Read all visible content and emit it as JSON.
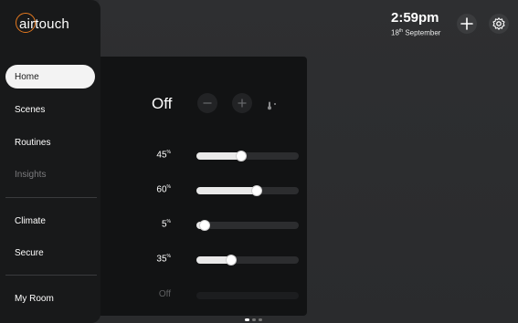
{
  "app": {
    "logo_text": "airtouch"
  },
  "sidebar": {
    "items": [
      {
        "label": "Home",
        "state": "active"
      },
      {
        "label": "Scenes",
        "state": "normal"
      },
      {
        "label": "Routines",
        "state": "normal"
      },
      {
        "label": "Insights",
        "state": "dim"
      },
      {
        "label": "Climate",
        "state": "normal"
      },
      {
        "label": "Secure",
        "state": "normal"
      },
      {
        "label": "My Room",
        "state": "normal"
      }
    ]
  },
  "header": {
    "time": "2:59pm",
    "date_day": "18",
    "date_suffix": "th",
    "date_month": "September",
    "add_icon": "plus-icon",
    "settings_icon": "gear-icon"
  },
  "panel": {
    "status": "Off",
    "minus_icon": "minus-icon",
    "plus_icon": "plus-icon",
    "thermo_icon": "thermometer-icon",
    "zones": [
      {
        "value": "45",
        "unit": "%",
        "level": 0.45,
        "enabled": true
      },
      {
        "value": "60",
        "unit": "%",
        "level": 0.6,
        "enabled": true
      },
      {
        "value": "5",
        "unit": "%",
        "level": 0.05,
        "enabled": true
      },
      {
        "value": "35",
        "unit": "%",
        "level": 0.35,
        "enabled": true
      },
      {
        "value": "Off",
        "unit": "",
        "level": 0,
        "enabled": false
      }
    ]
  },
  "pager": {
    "count": 3,
    "active": 0
  }
}
